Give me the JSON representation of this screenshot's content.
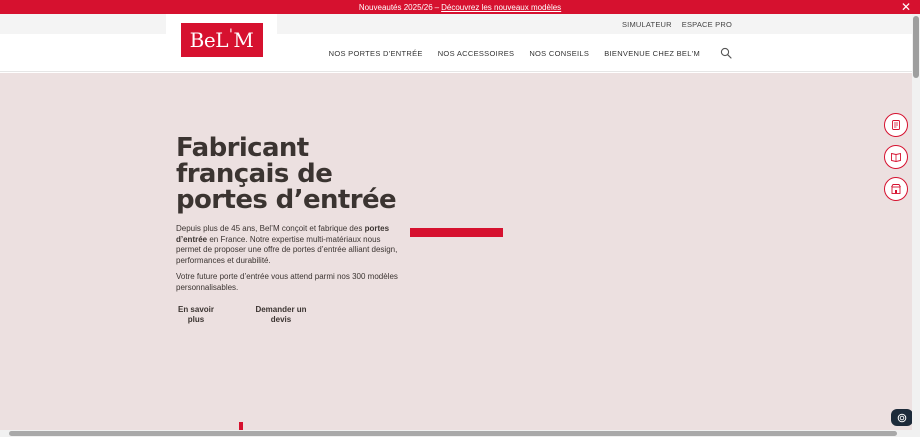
{
  "promo": {
    "text": "Nouveautés 2025/26",
    "separator": "–",
    "link": "Découvrez les nouveaux modèles",
    "close": "✕"
  },
  "utility": {
    "simulator": "SIMULATEUR",
    "pro": "ESPACE PRO"
  },
  "logo": {
    "left": "BeL",
    "tick": "'",
    "right": "M"
  },
  "nav": {
    "items": [
      "NOS PORTES D'ENTRÉE",
      "NOS ACCESSOIRES",
      "NOS CONSEILS",
      "BIENVENUE CHEZ BEL'M"
    ]
  },
  "hero": {
    "title_line1": "Fabricant",
    "title_line2": "français de",
    "title_line3": "portes d’entrée",
    "p1_a": "Depuis plus de 45 ans, Bel’M conçoit et fabrique des ",
    "p1_b": "portes d’entrée",
    "p1_c": " en France. Notre expertise multi-matériaux nous permet de proposer une offre de portes d’entrée alliant design, performances et durabilité.",
    "p2": "Votre future porte d’entrée vous attend parmi nos 300 modèles personnalisables.",
    "btn_more": "En savoir plus",
    "btn_quote": "Demander un devis"
  },
  "colors": {
    "brand_red": "#d6112f",
    "hero_bg": "#ece0e0",
    "text_dark": "#3b3431"
  },
  "icons": [
    "document-icon",
    "catalog-book-icon",
    "showroom-icon",
    "chat-icon",
    "search-icon",
    "close-icon"
  ]
}
